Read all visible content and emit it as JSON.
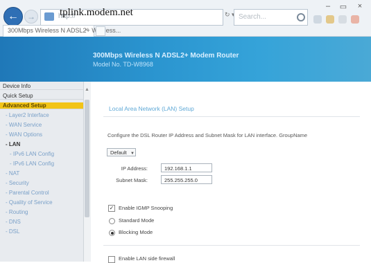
{
  "browser": {
    "url": "tplink.modem.net",
    "address_prefix": "http://",
    "search_placeholder": "Search...",
    "tab_title": "300Mbps Wireless N ADSL2+ Wireless...",
    "controls": {
      "minimize": "–",
      "maximize": "▭",
      "close": "×"
    }
  },
  "banner": {
    "title": "300Mbps Wireless N ADSL2+ Modem Router",
    "model": "Model No. TD-W8968"
  },
  "sidebar": {
    "items": [
      {
        "label": "Device Info",
        "level": "top"
      },
      {
        "label": "Quick Setup",
        "level": "top"
      },
      {
        "label": "Advanced Setup",
        "level": "top",
        "active": true
      },
      {
        "label": "- Layer2 Interface",
        "level": "sub"
      },
      {
        "label": "- WAN Service",
        "level": "sub"
      },
      {
        "label": "- WAN Options",
        "level": "sub"
      },
      {
        "label": "- LAN",
        "level": "sub",
        "current": true
      },
      {
        "label": "- IPv6 LAN Config",
        "level": "subsub"
      },
      {
        "label": "- IPv6 LAN Config",
        "level": "subsub"
      },
      {
        "label": "- NAT",
        "level": "sub"
      },
      {
        "label": "- Security",
        "level": "sub"
      },
      {
        "label": "- Parental Control",
        "level": "sub"
      },
      {
        "label": "- Quality of Service",
        "level": "sub"
      },
      {
        "label": "- Routing",
        "level": "sub"
      },
      {
        "label": "- DNS",
        "level": "sub"
      },
      {
        "label": "- DSL",
        "level": "sub"
      }
    ]
  },
  "main": {
    "section_title": "Local Area Network (LAN) Setup",
    "description": "Configure the DSL Router IP Address and Subnet Mask for LAN interface.  GroupName",
    "group_select": "Default",
    "ip_address_label": "IP Address:",
    "ip_address_value": "192.168.1.1",
    "subnet_mask_label": "Subnet Mask:",
    "subnet_mask_value": "255.255.255.0",
    "igmp_snooping_label": "Enable IGMP Snooping",
    "standard_mode_label": "Standard Mode",
    "blocking_mode_label": "Blocking Mode",
    "lan_firewall_label": "Enable LAN side firewall"
  },
  "colors": {
    "banner_blue": "#2a94cf",
    "active_menu": "#f2c418",
    "link_blue": "#5ea8d6"
  }
}
